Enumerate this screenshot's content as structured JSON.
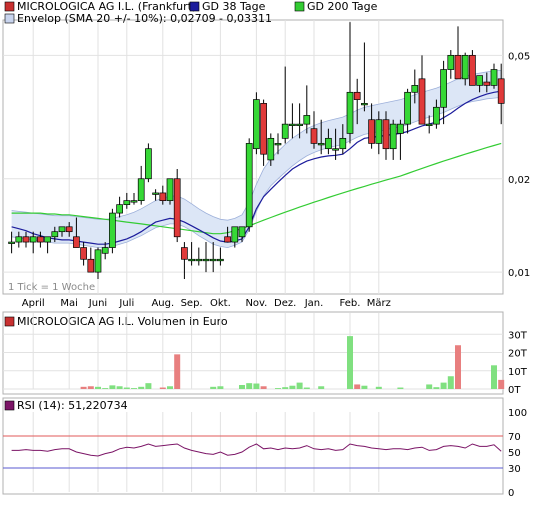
{
  "colors": {
    "up": "#36d836",
    "down": "#e03a3a",
    "ma38": "#1c1c9c",
    "ma200": "#33cc33",
    "envelope_fill": "#dce6f6",
    "envelope_line": "#9db0da",
    "vol_up": "#80e080",
    "vol_down": "#e87f7f",
    "rsi_line": "#7b1466",
    "rsi_upper": "#e05a5a",
    "rsi_lower": "#5a5ad0",
    "panel_bg": "#ffffff",
    "frame": "#b0b0b0",
    "grid": "#e2e2e2"
  },
  "price_panel": {
    "legend": [
      {
        "label": "MICROLOGICA AG I.L. (Frankfurt)",
        "swatch": "#c83030"
      },
      {
        "label": "GD 38 Tage",
        "swatch": "#1c1c9c"
      },
      {
        "label": "GD 200 Tage",
        "swatch": "#33cc33"
      }
    ],
    "legend2": {
      "label": "Envelop (SMA 20 +/- 10%): 0,02709 - 0,03311",
      "swatch": "#c8d4ee"
    },
    "note": "1 Tick = 1 Woche"
  },
  "volume_panel": {
    "label": "MICROLOGICA AG I.L. Volumen in Euro",
    "swatch": "#c83030"
  },
  "rsi_panel": {
    "label": "RSI (14): 51,220734",
    "swatch": "#7b1466"
  },
  "chart_data": [
    {
      "type": "candlestick",
      "title": "MICROLOGICA AG I.L. (Frankfurt)",
      "y_scale": "log",
      "ylim": [
        0.0085,
        0.065
      ],
      "yticks": [
        {
          "value": 0.01,
          "label": "0,01"
        },
        {
          "value": 0.02,
          "label": "0,02"
        },
        {
          "value": 0.05,
          "label": "0,05"
        }
      ],
      "x_labels": [
        "April",
        "Mai",
        "Juni",
        "Juli",
        "Aug.",
        "Sep.",
        "Okt.",
        "Nov.",
        "Dez.",
        "Jan.",
        "Feb.",
        "März"
      ],
      "x_label_week": [
        4,
        9,
        13,
        17,
        22,
        26,
        30,
        35,
        39,
        43,
        48,
        52
      ],
      "candles": [
        [
          0.0125,
          0.0135,
          0.0115,
          0.0125
        ],
        [
          0.0125,
          0.0135,
          0.012,
          0.013
        ],
        [
          0.013,
          0.0135,
          0.012,
          0.0125
        ],
        [
          0.0125,
          0.0135,
          0.0115,
          0.013
        ],
        [
          0.013,
          0.0135,
          0.012,
          0.0125
        ],
        [
          0.0125,
          0.013,
          0.0115,
          0.013
        ],
        [
          0.013,
          0.014,
          0.0125,
          0.0135
        ],
        [
          0.0135,
          0.014,
          0.013,
          0.014
        ],
        [
          0.014,
          0.0145,
          0.013,
          0.0135
        ],
        [
          0.013,
          0.015,
          0.012,
          0.012
        ],
        [
          0.012,
          0.0125,
          0.0105,
          0.011
        ],
        [
          0.011,
          0.012,
          0.01,
          0.01
        ],
        [
          0.01,
          0.012,
          0.0095,
          0.0118
        ],
        [
          0.0115,
          0.0125,
          0.011,
          0.012
        ],
        [
          0.012,
          0.016,
          0.0115,
          0.0155
        ],
        [
          0.0155,
          0.0175,
          0.015,
          0.0165
        ],
        [
          0.0165,
          0.018,
          0.016,
          0.017
        ],
        [
          0.017,
          0.018,
          0.0165,
          0.017
        ],
        [
          0.017,
          0.022,
          0.0165,
          0.02
        ],
        [
          0.02,
          0.026,
          0.0195,
          0.025
        ],
        [
          0.018,
          0.0185,
          0.017,
          0.018
        ],
        [
          0.018,
          0.019,
          0.0165,
          0.017
        ],
        [
          0.017,
          0.02,
          0.0165,
          0.02
        ],
        [
          0.02,
          0.0215,
          0.0125,
          0.013
        ],
        [
          0.012,
          0.0125,
          0.0095,
          0.011
        ],
        [
          0.011,
          0.0125,
          0.0105,
          0.011
        ],
        [
          0.011,
          0.012,
          0.0105,
          0.011
        ],
        [
          0.011,
          0.0125,
          0.01,
          0.011
        ],
        [
          0.011,
          0.0125,
          0.01,
          0.011
        ],
        [
          0.011,
          0.012,
          0.0105,
          0.011
        ],
        [
          0.013,
          0.014,
          0.0125,
          0.0125
        ],
        [
          0.0125,
          0.014,
          0.012,
          0.014
        ],
        [
          0.013,
          0.014,
          0.0125,
          0.014
        ],
        [
          0.014,
          0.027,
          0.0135,
          0.026
        ],
        [
          0.025,
          0.038,
          0.024,
          0.036
        ],
        [
          0.035,
          0.036,
          0.022,
          0.024
        ],
        [
          0.023,
          0.028,
          0.022,
          0.027
        ],
        [
          0.026,
          0.028,
          0.024,
          0.026
        ],
        [
          0.027,
          0.046,
          0.026,
          0.03
        ],
        [
          0.03,
          0.035,
          0.027,
          0.03
        ],
        [
          0.03,
          0.035,
          0.027,
          0.03
        ],
        [
          0.03,
          0.04,
          0.028,
          0.032
        ],
        [
          0.029,
          0.033,
          0.025,
          0.026
        ],
        [
          0.026,
          0.031,
          0.024,
          0.026
        ],
        [
          0.025,
          0.029,
          0.024,
          0.027
        ],
        [
          0.025,
          0.029,
          0.023,
          0.025
        ],
        [
          0.025,
          0.03,
          0.024,
          0.027
        ],
        [
          0.028,
          0.064,
          0.026,
          0.038
        ],
        [
          0.038,
          0.042,
          0.03,
          0.036
        ],
        [
          0.035,
          0.055,
          0.033,
          0.035
        ],
        [
          0.031,
          0.035,
          0.025,
          0.026
        ],
        [
          0.026,
          0.033,
          0.024,
          0.031
        ],
        [
          0.031,
          0.033,
          0.023,
          0.025
        ],
        [
          0.025,
          0.031,
          0.023,
          0.03
        ],
        [
          0.028,
          0.031,
          0.023,
          0.03
        ],
        [
          0.03,
          0.039,
          0.028,
          0.038
        ],
        [
          0.038,
          0.045,
          0.035,
          0.04
        ],
        [
          0.042,
          0.05,
          0.03,
          0.03
        ],
        [
          0.03,
          0.032,
          0.028,
          0.03
        ],
        [
          0.03,
          0.036,
          0.029,
          0.034
        ],
        [
          0.034,
          0.048,
          0.03,
          0.045
        ],
        [
          0.045,
          0.052,
          0.042,
          0.05
        ],
        [
          0.05,
          0.062,
          0.042,
          0.042
        ],
        [
          0.042,
          0.051,
          0.04,
          0.05
        ],
        [
          0.05,
          0.052,
          0.04,
          0.04
        ],
        [
          0.04,
          0.043,
          0.038,
          0.043
        ],
        [
          0.041,
          0.044,
          0.038,
          0.04
        ],
        [
          0.04,
          0.047,
          0.039,
          0.045
        ],
        [
          0.042,
          0.047,
          0.03,
          0.035
        ]
      ],
      "sma38": [
        0.014,
        0.0138,
        0.0136,
        0.0133,
        0.0131,
        0.0129,
        0.0128,
        0.0127,
        0.0127,
        0.0126,
        0.0125,
        0.0124,
        0.0123,
        0.0123,
        0.0124,
        0.0126,
        0.0128,
        0.0131,
        0.0135,
        0.014,
        0.0145,
        0.0147,
        0.0149,
        0.0148,
        0.0145,
        0.0141,
        0.0137,
        0.0133,
        0.0129,
        0.0126,
        0.0125,
        0.0126,
        0.0128,
        0.014,
        0.016,
        0.0175,
        0.0185,
        0.0195,
        0.0205,
        0.0215,
        0.0222,
        0.0228,
        0.0232,
        0.0235,
        0.0237,
        0.0238,
        0.024,
        0.025,
        0.0262,
        0.027,
        0.0272,
        0.0274,
        0.0276,
        0.0278,
        0.028,
        0.0284,
        0.029,
        0.0296,
        0.03,
        0.0305,
        0.0315,
        0.0325,
        0.0338,
        0.035,
        0.036,
        0.0368,
        0.0375,
        0.038,
        0.0383
      ],
      "sma200": [
        0.0155,
        0.0155,
        0.0155,
        0.0155,
        0.0155,
        0.0154,
        0.0154,
        0.0153,
        0.0153,
        0.0152,
        0.0151,
        0.015,
        0.0149,
        0.0148,
        0.0147,
        0.0146,
        0.0145,
        0.0144,
        0.0143,
        0.0142,
        0.0141,
        0.014,
        0.0139,
        0.0138,
        0.0137,
        0.0136,
        0.0135,
        0.0134,
        0.0133,
        0.0133,
        0.0134,
        0.0136,
        0.0138,
        0.0141,
        0.0144,
        0.0147,
        0.015,
        0.0153,
        0.0156,
        0.0159,
        0.0162,
        0.0165,
        0.0168,
        0.0171,
        0.0174,
        0.0177,
        0.018,
        0.0183,
        0.0186,
        0.0189,
        0.0192,
        0.0195,
        0.0198,
        0.0201,
        0.0204,
        0.0208,
        0.0212,
        0.0216,
        0.022,
        0.0224,
        0.0228,
        0.0232,
        0.0236,
        0.024,
        0.0244,
        0.0248,
        0.0252,
        0.0256,
        0.026
      ],
      "envelope_upper": [
        0.0158,
        0.0157,
        0.0156,
        0.0155,
        0.0154,
        0.0153,
        0.0152,
        0.0152,
        0.0152,
        0.0151,
        0.015,
        0.0149,
        0.0148,
        0.0148,
        0.0149,
        0.0151,
        0.0153,
        0.0156,
        0.016,
        0.0165,
        0.017,
        0.0173,
        0.0176,
        0.0176,
        0.0172,
        0.0166,
        0.016,
        0.0155,
        0.0151,
        0.0148,
        0.0147,
        0.0149,
        0.0153,
        0.0168,
        0.0192,
        0.0215,
        0.0232,
        0.0245,
        0.0258,
        0.027,
        0.028,
        0.029,
        0.0297,
        0.0303,
        0.0308,
        0.0312,
        0.0316,
        0.0324,
        0.0333,
        0.034,
        0.0344,
        0.0348,
        0.0352,
        0.0356,
        0.036,
        0.0366,
        0.0373,
        0.038,
        0.0386,
        0.0392,
        0.04,
        0.041,
        0.042,
        0.0428,
        0.0434,
        0.0438,
        0.0442,
        0.0445,
        0.0447
      ],
      "envelope_lower": [
        0.013,
        0.0129,
        0.0128,
        0.0127,
        0.0126,
        0.0125,
        0.0124,
        0.0124,
        0.0124,
        0.0123,
        0.0122,
        0.0121,
        0.012,
        0.012,
        0.0121,
        0.0123,
        0.0125,
        0.0128,
        0.0131,
        0.0135,
        0.0139,
        0.0141,
        0.0143,
        0.0143,
        0.014,
        0.0136,
        0.0131,
        0.0127,
        0.0123,
        0.0121,
        0.012,
        0.0122,
        0.0125,
        0.0137,
        0.0157,
        0.0176,
        0.019,
        0.02,
        0.021,
        0.022,
        0.0229,
        0.0237,
        0.0243,
        0.0248,
        0.0252,
        0.0255,
        0.0258,
        0.0265,
        0.0272,
        0.0278,
        0.0281,
        0.0284,
        0.0288,
        0.0291,
        0.0294,
        0.0299,
        0.0305,
        0.0311,
        0.0316,
        0.0321,
        0.0327,
        0.0335,
        0.0343,
        0.035,
        0.0355,
        0.0358,
        0.0362,
        0.0364,
        0.0366
      ]
    },
    {
      "type": "bar",
      "title": "MICROLOGICA AG I.L. Volumen in Euro",
      "ylim": [
        0,
        34000
      ],
      "yticks": [
        {
          "value": 0,
          "label": "0T"
        },
        {
          "value": 10000,
          "label": "10T"
        },
        {
          "value": 20000,
          "label": "20T"
        },
        {
          "value": 30000,
          "label": "30T"
        }
      ],
      "values": [
        0,
        0,
        0,
        0,
        0,
        0,
        0,
        0,
        0,
        0,
        1200,
        1500,
        1200,
        500,
        2000,
        1500,
        800,
        500,
        1200,
        3200,
        0,
        800,
        1500,
        19000,
        0,
        0,
        0,
        0,
        1200,
        1500,
        0,
        0,
        2200,
        3200,
        3000,
        1500,
        0,
        500,
        1000,
        1800,
        3500,
        800,
        0,
        1500,
        0,
        0,
        0,
        29000,
        2500,
        1800,
        0,
        1200,
        0,
        0,
        800,
        0,
        0,
        0,
        2500,
        1000,
        3500,
        7000,
        24000,
        0,
        0,
        0,
        0,
        13000,
        5000
      ]
    },
    {
      "type": "line",
      "title": "RSI (14): 51,220734",
      "ylim": [
        0,
        100
      ],
      "yticks": [
        {
          "value": 0,
          "label": "0"
        },
        {
          "value": 30,
          "label": "30"
        },
        {
          "value": 50,
          "label": "50"
        },
        {
          "value": 70,
          "label": "70"
        },
        {
          "value": 100,
          "label": "100"
        }
      ],
      "reference_lines": [
        70,
        30
      ],
      "values": [
        52,
        52,
        53,
        52,
        52,
        51,
        53,
        54,
        54,
        50,
        48,
        46,
        45,
        48,
        50,
        54,
        56,
        55,
        57,
        60,
        57,
        58,
        59,
        60,
        55,
        52,
        50,
        48,
        47,
        50,
        46,
        47,
        50,
        56,
        60,
        54,
        55,
        53,
        55,
        54,
        55,
        58,
        54,
        53,
        54,
        52,
        53,
        60,
        58,
        57,
        55,
        54,
        53,
        54,
        54,
        53,
        55,
        56,
        52,
        53,
        57,
        58,
        57,
        55,
        60,
        57,
        57,
        59,
        51
      ]
    }
  ]
}
